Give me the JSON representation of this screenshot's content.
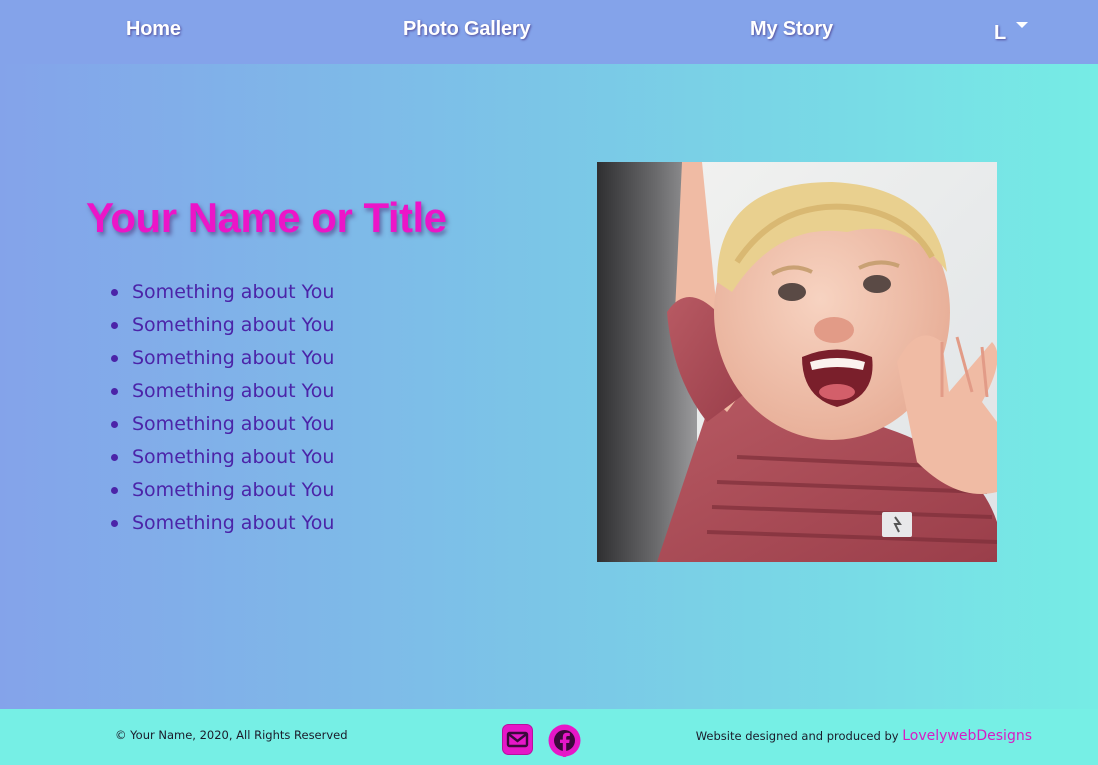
{
  "nav": {
    "items": [
      {
        "label": "Home"
      },
      {
        "label": "Photo Gallery"
      },
      {
        "label": "My Story"
      }
    ],
    "dropdown_label": "L"
  },
  "main": {
    "title": "Your Name or Title",
    "about_items": [
      "Something about You",
      "Something about You",
      "Something about You",
      "Something about You",
      "Something about You",
      "Something about You",
      "Something about You",
      "Something about You"
    ],
    "photo_icon": "child-photo"
  },
  "footer": {
    "copyright": "© Your Name, 2020, All Rights Reserved",
    "icons": [
      "email-icon",
      "facebook-icon"
    ],
    "credit_prefix": "Website designed and produced by",
    "credit_link": "LovelywebDesigns"
  },
  "colors": {
    "nav_bg": "#84a3ea",
    "title": "#ec15c8",
    "list_text": "#4b24a8",
    "footer_bg": "#76efe5",
    "accent": "#e617c8"
  }
}
